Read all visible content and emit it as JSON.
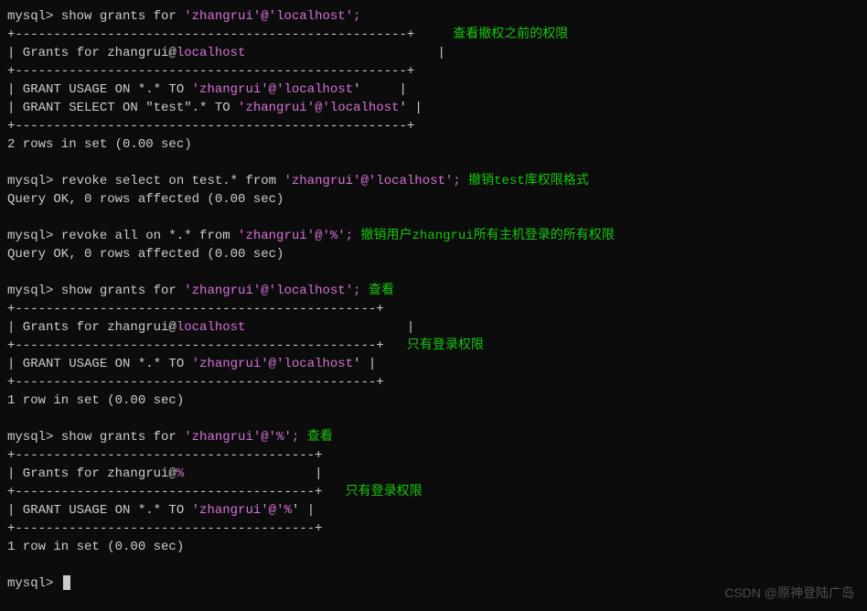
{
  "annot": {
    "before": "查看撤权之前的权限",
    "revoke_test": "撤销test库权限格式",
    "revoke_all": "撤销用户zhangrui所有主机登录的所有权限",
    "view1": "查看",
    "only_login1": "只有登录权限",
    "view2": "查看",
    "only_login2": "只有登录权限"
  },
  "q1": {
    "prompt": "mysql> ",
    "cmd_pre": "show grants for ",
    "user_q": "'",
    "user": "zhangrui",
    "at": "'@'",
    "host": "localhost",
    "end": "';",
    "border_top": "+---------------------------------------------------+",
    "header": "| Grants for zhangrui@",
    "header_host": "localhost",
    "header_pad": "                         |",
    "border_mid": "+---------------------------------------------------+",
    "row1_a": "| GRANT USAGE ON *.* TO ",
    "row1_user": "zhangrui",
    "row1_at": "'@'",
    "row1_host": "localhost",
    "row1_end": "'     |",
    "row2_a": "| GRANT SELECT ON \"test\".* TO ",
    "row2_user": "zhangrui",
    "row2_at": "'@'",
    "row2_host": "localhost",
    "row2_end": "' |",
    "border_bot": "+---------------------------------------------------+",
    "result": "2 rows in set (0.00 sec)"
  },
  "q2": {
    "prompt": "mysql> ",
    "cmd_pre": "revoke select on test.* from ",
    "user": "zhangrui",
    "at": "'@'",
    "host": "localhost",
    "end": "';",
    "result": "Query OK, 0 rows affected (0.00 sec)"
  },
  "q3": {
    "prompt": "mysql> ",
    "cmd_pre": "revoke all on *.* from ",
    "user": "zhangrui",
    "at": "'@'",
    "host": "%",
    "end": "';",
    "result": "Query OK, 0 rows affected (0.00 sec)"
  },
  "q4": {
    "prompt": "mysql> ",
    "cmd_pre": "show grants for ",
    "user": "zhangrui",
    "at": "'@'",
    "host": "localhost",
    "end": "';",
    "border_top": "+-----------------------------------------------+",
    "header": "| Grants for zhangrui@",
    "header_host": "localhost",
    "header_pad": "                     |",
    "border_mid": "+-----------------------------------------------+",
    "row1_a": "| GRANT USAGE ON *.* TO ",
    "row1_user": "zhangrui",
    "row1_at": "'@'",
    "row1_host": "localhost",
    "row1_end": "' |",
    "border_bot": "+-----------------------------------------------+",
    "result": "1 row in set (0.00 sec)"
  },
  "q5": {
    "prompt": "mysql> ",
    "cmd_pre": "show grants for ",
    "user": "zhangrui",
    "at": "'@'",
    "host": "%",
    "end": "';",
    "border_top": "+---------------------------------------+",
    "header": "| Grants for zhangrui@",
    "header_host": "%",
    "header_pad": "                 |",
    "border_mid": "+---------------------------------------+",
    "row1_a": "| GRANT USAGE ON *.* TO ",
    "row1_user": "zhangrui",
    "row1_at": "'@'",
    "row1_host": "%",
    "row1_end": "' |",
    "border_bot": "+---------------------------------------+",
    "result": "1 row in set (0.00 sec)"
  },
  "final_prompt": "mysql> ",
  "watermark": "CSDN @原神登陆广岛"
}
